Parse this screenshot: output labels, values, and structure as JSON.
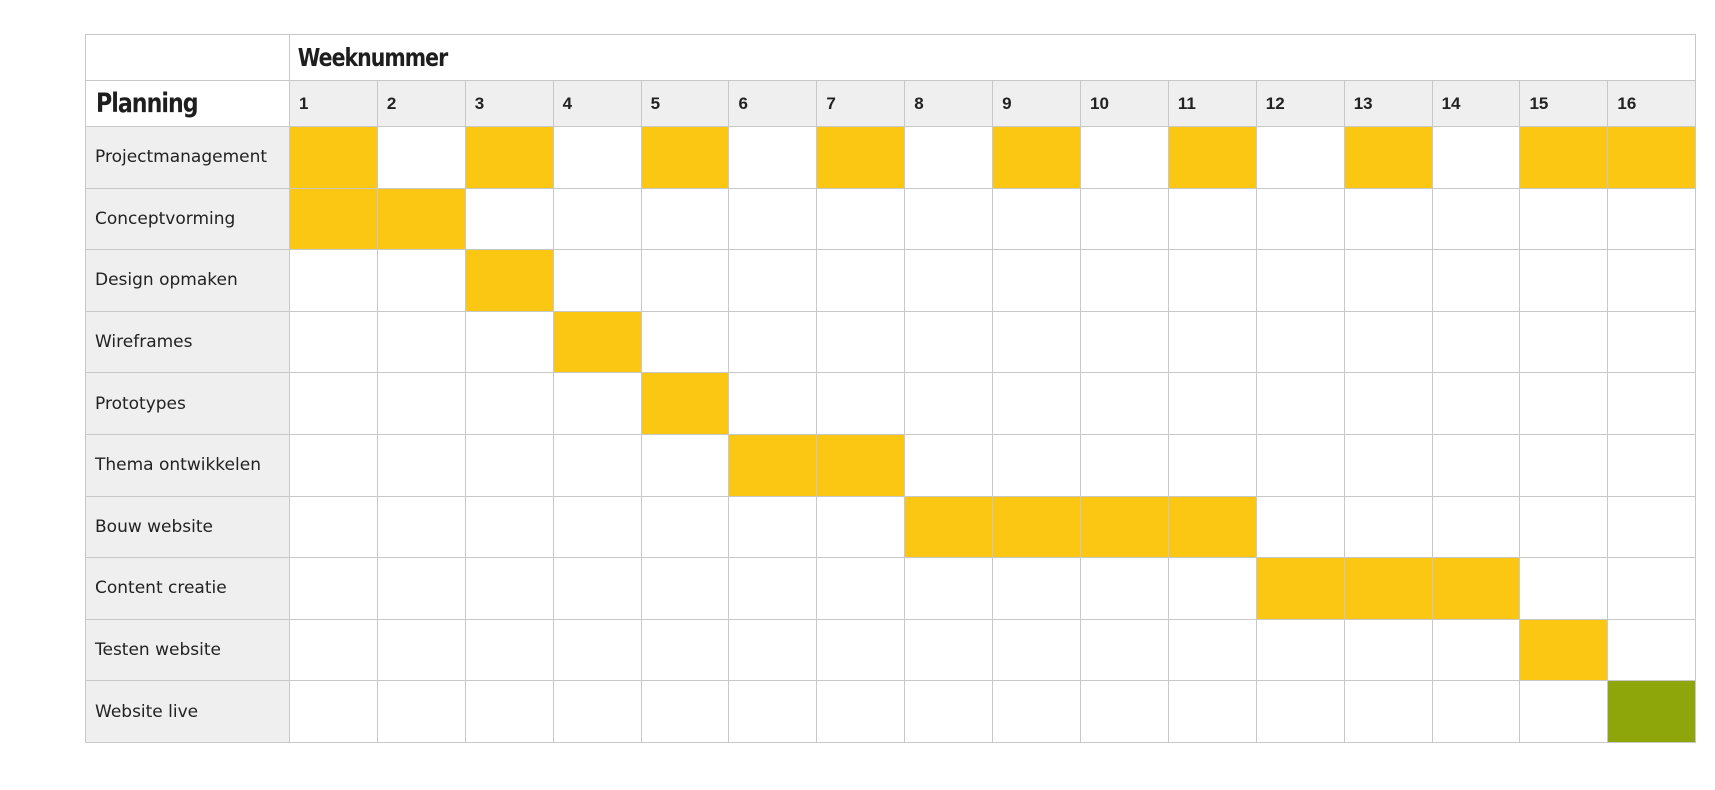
{
  "header": {
    "title": "Planning",
    "week_header": "Weeknummer"
  },
  "colors": {
    "planned": "#fcc712",
    "milestone": "#8ea60a",
    "label_bg": "#efefef",
    "grid": "#c8c8c8"
  },
  "chart_data": {
    "type": "table",
    "weeks": [
      "1",
      "2",
      "3",
      "4",
      "5",
      "6",
      "7",
      "8",
      "9",
      "10",
      "11",
      "12",
      "13",
      "14",
      "15",
      "16"
    ],
    "tasks": [
      {
        "name": "Projectmanagement",
        "weeks": [
          1,
          3,
          5,
          7,
          9,
          11,
          13,
          15,
          16
        ],
        "kind": "planned"
      },
      {
        "name": "Conceptvorming",
        "weeks": [
          1,
          2
        ],
        "kind": "planned"
      },
      {
        "name": "Design opmaken",
        "weeks": [
          3
        ],
        "kind": "planned"
      },
      {
        "name": "Wireframes",
        "weeks": [
          4
        ],
        "kind": "planned"
      },
      {
        "name": "Prototypes",
        "weeks": [
          5
        ],
        "kind": "planned"
      },
      {
        "name": "Thema ontwikkelen",
        "weeks": [
          6,
          7
        ],
        "kind": "planned"
      },
      {
        "name": "Bouw website",
        "weeks": [
          8,
          9,
          10,
          11
        ],
        "kind": "planned"
      },
      {
        "name": "Content creatie",
        "weeks": [
          12,
          13,
          14
        ],
        "kind": "planned"
      },
      {
        "name": "Testen website",
        "weeks": [
          15
        ],
        "kind": "planned"
      },
      {
        "name": "Website live",
        "weeks": [
          16
        ],
        "kind": "milestone"
      }
    ]
  }
}
